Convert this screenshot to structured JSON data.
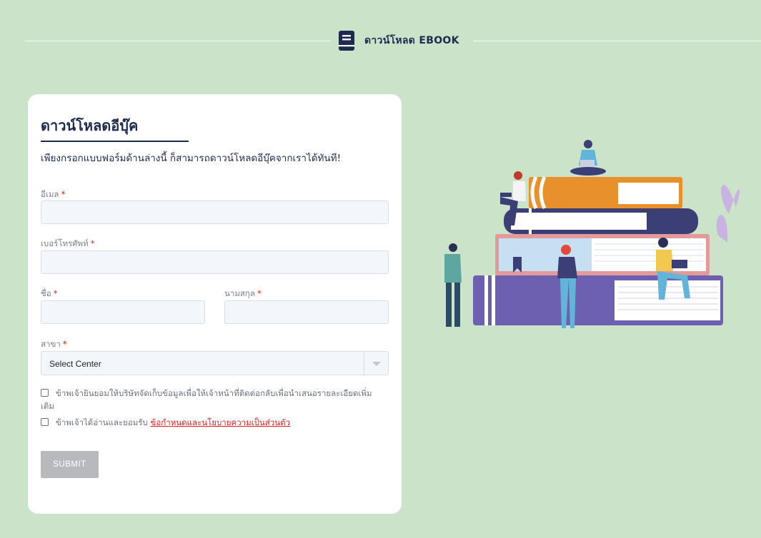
{
  "header": {
    "title": "ดาวน์โหลด EBOOK",
    "icon": "book-icon"
  },
  "form": {
    "title": "ดาวน์โหลดอีบุ๊ค",
    "subtitle": "เพียงกรอกแบบฟอร์มด้านล่างนี้ ก็สามารถดาวน์โหลดอีบุ๊คจากเราได้ทันที!",
    "required_mark": "*",
    "email": {
      "label": "อีเมล",
      "value": "",
      "placeholder": ""
    },
    "phone": {
      "label": "เบอร์โทรศัพท์",
      "value": "",
      "placeholder": ""
    },
    "first_name": {
      "label": "ชื่อ",
      "value": "",
      "placeholder": ""
    },
    "last_name": {
      "label": "นามสกุล",
      "value": "",
      "placeholder": ""
    },
    "branch": {
      "label": "สาขา",
      "selected": "Select Center"
    },
    "consent_1": {
      "text_line1": "ข้าพเจ้ายินยอมให้บริษัทจัดเก็บข้อมูลเพื่อให้เจ้าหน้าที่ติดต่อกลับเพื่อนำเสนอรายละเอียดเพิ่ม",
      "text_line2": "เติม",
      "checked": false
    },
    "consent_2": {
      "text": "ข้าพเจ้าได้อ่านและยอมรับ",
      "link_text": "ข้อกำหนดและนโยบายความเป็นส่วนตัว",
      "checked": false
    },
    "submit_label": "SUBMIT"
  },
  "colors": {
    "background": "#cbe4c9",
    "navy": "#1d2b4f",
    "required": "#e01b1b",
    "submit_disabled": "#b7b9bc"
  },
  "illustration": {
    "icon": "books-with-people-illustration"
  }
}
